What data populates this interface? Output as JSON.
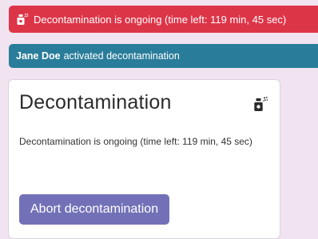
{
  "alert": {
    "icon": "spray-bottle-icon",
    "text": "Decontamination is ongoing (time left: 119 min, 45 sec)",
    "color": "#dd3548"
  },
  "activity": {
    "user": "Jane Doe",
    "action": "activated decontamination",
    "color": "#2a7d9a"
  },
  "card": {
    "title": "Decontamination",
    "icon": "spray-bottle-icon",
    "status_text": "Decontamination is ongoing (time left: 119 min, 45 sec)",
    "abort_label": "Abort decontamination",
    "button_color": "#7271b7"
  },
  "page": {
    "background": "#f2e3f0"
  }
}
